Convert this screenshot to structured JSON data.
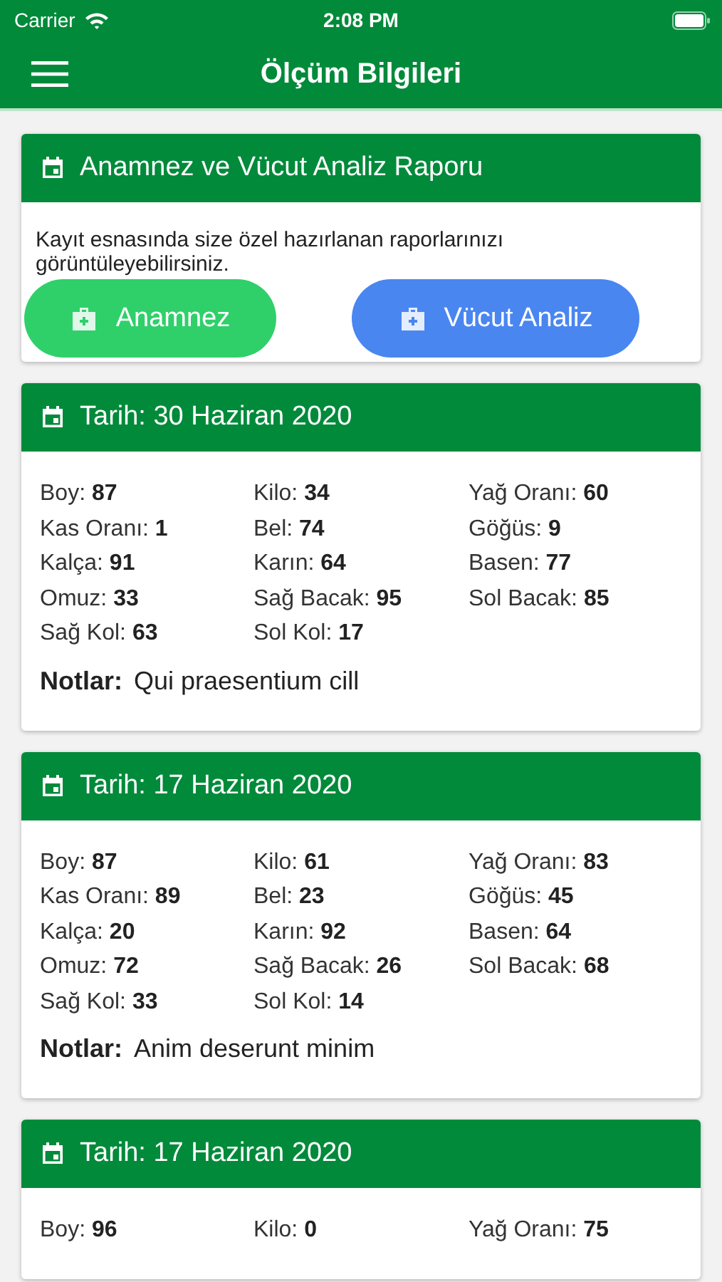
{
  "status_bar": {
    "carrier": "Carrier",
    "time": "2:08 PM"
  },
  "nav": {
    "title": "Ölçüm Bilgileri"
  },
  "report": {
    "title": "Anamnez ve Vücut Analiz Raporu",
    "text": "Kayıt esnasında size özel hazırlanan raporlarınızı görüntüleyebilirsiniz.",
    "buttons": [
      {
        "label": "Anamnez",
        "color": "#2fd06a"
      },
      {
        "label": "Vücut Analiz",
        "color": "#4a86f0"
      }
    ]
  },
  "measurements": [
    {
      "date": "Tarih: 30 Haziran 2020",
      "metrics": [
        {
          "label": "Boy:",
          "value": "87"
        },
        {
          "label": "Kilo:",
          "value": "34"
        },
        {
          "label": "Yağ Oranı:",
          "value": "60"
        },
        {
          "label": "Kas Oranı:",
          "value": "1"
        },
        {
          "label": "Bel:",
          "value": "74"
        },
        {
          "label": "Göğüs:",
          "value": "9"
        },
        {
          "label": "Kalça:",
          "value": "91"
        },
        {
          "label": "Karın:",
          "value": "64"
        },
        {
          "label": "Basen:",
          "value": "77"
        },
        {
          "label": "Omuz:",
          "value": "33"
        },
        {
          "label": "Sağ Bacak:",
          "value": "95"
        },
        {
          "label": "Sol Bacak:",
          "value": "85"
        },
        {
          "label": "Sağ Kol:",
          "value": "63"
        },
        {
          "label": "Sol Kol:",
          "value": "17"
        }
      ],
      "notes_label": "Notlar:",
      "notes": "Qui praesentium cill"
    },
    {
      "date": "Tarih: 17 Haziran 2020",
      "metrics": [
        {
          "label": "Boy:",
          "value": "87"
        },
        {
          "label": "Kilo:",
          "value": "61"
        },
        {
          "label": "Yağ Oranı:",
          "value": "83"
        },
        {
          "label": "Kas Oranı:",
          "value": "89"
        },
        {
          "label": "Bel:",
          "value": "23"
        },
        {
          "label": "Göğüs:",
          "value": "45"
        },
        {
          "label": "Kalça:",
          "value": "20"
        },
        {
          "label": "Karın:",
          "value": "92"
        },
        {
          "label": "Basen:",
          "value": "64"
        },
        {
          "label": "Omuz:",
          "value": "72"
        },
        {
          "label": "Sağ Bacak:",
          "value": "26"
        },
        {
          "label": "Sol Bacak:",
          "value": "68"
        },
        {
          "label": "Sağ Kol:",
          "value": "33"
        },
        {
          "label": "Sol Kol:",
          "value": "14"
        }
      ],
      "notes_label": "Notlar:",
      "notes": "Anim deserunt minim"
    },
    {
      "date": "Tarih: 17 Haziran 2020",
      "metrics": [
        {
          "label": "Boy:",
          "value": "96"
        },
        {
          "label": "Kilo:",
          "value": "0"
        },
        {
          "label": "Yağ Oranı:",
          "value": "75"
        }
      ]
    }
  ]
}
